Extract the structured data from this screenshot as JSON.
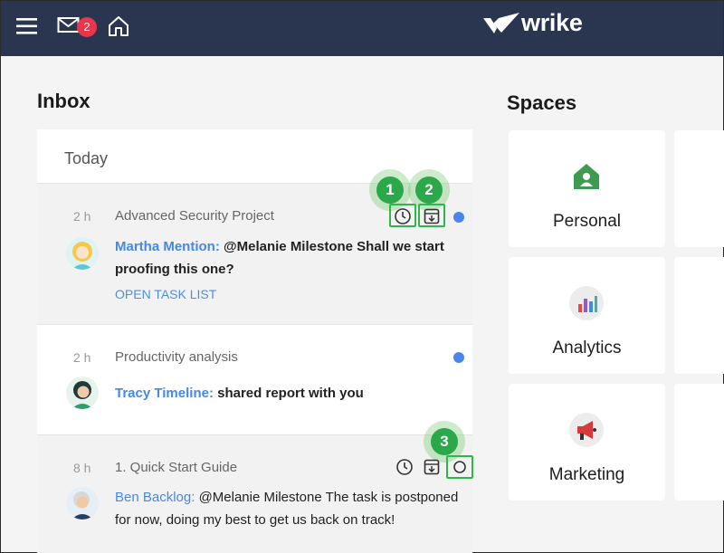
{
  "header": {
    "mail_badge": "2",
    "logo_text": "wrike"
  },
  "inbox": {
    "title": "Inbox",
    "section": "Today",
    "items": [
      {
        "age": "2 h",
        "project": "Advanced Security Project",
        "author": "Martha Mention:",
        "message": "@Melanie Milestone Shall we start proofing this one?",
        "link": "OPEN TASK LIST"
      },
      {
        "age": "2 h",
        "project": "Productivity analysis",
        "author": "Tracy Timeline:",
        "message": "shared report with you"
      },
      {
        "age": "8 h",
        "project": "1. Quick Start Guide",
        "author": "Ben Backlog:",
        "message": "@Melanie Milestone The task is postponed for now, doing my best to get us back on track!"
      }
    ],
    "steps": [
      "1",
      "2",
      "3"
    ]
  },
  "spaces": {
    "title": "Spaces",
    "items": [
      {
        "label": "Personal",
        "icon": "personal-space-icon",
        "color": "#3d9a50"
      },
      {
        "label": "Analytics",
        "icon": "analytics-chart-icon",
        "color": "#e44a4a"
      },
      {
        "label": "Marketing",
        "icon": "megaphone-icon",
        "color": "#d73a3a"
      }
    ]
  },
  "colors": {
    "topbar": "#2a3550",
    "accent": "#4688e4",
    "highlight": "#2fb84a",
    "unread_dot": "#4b86ec"
  }
}
